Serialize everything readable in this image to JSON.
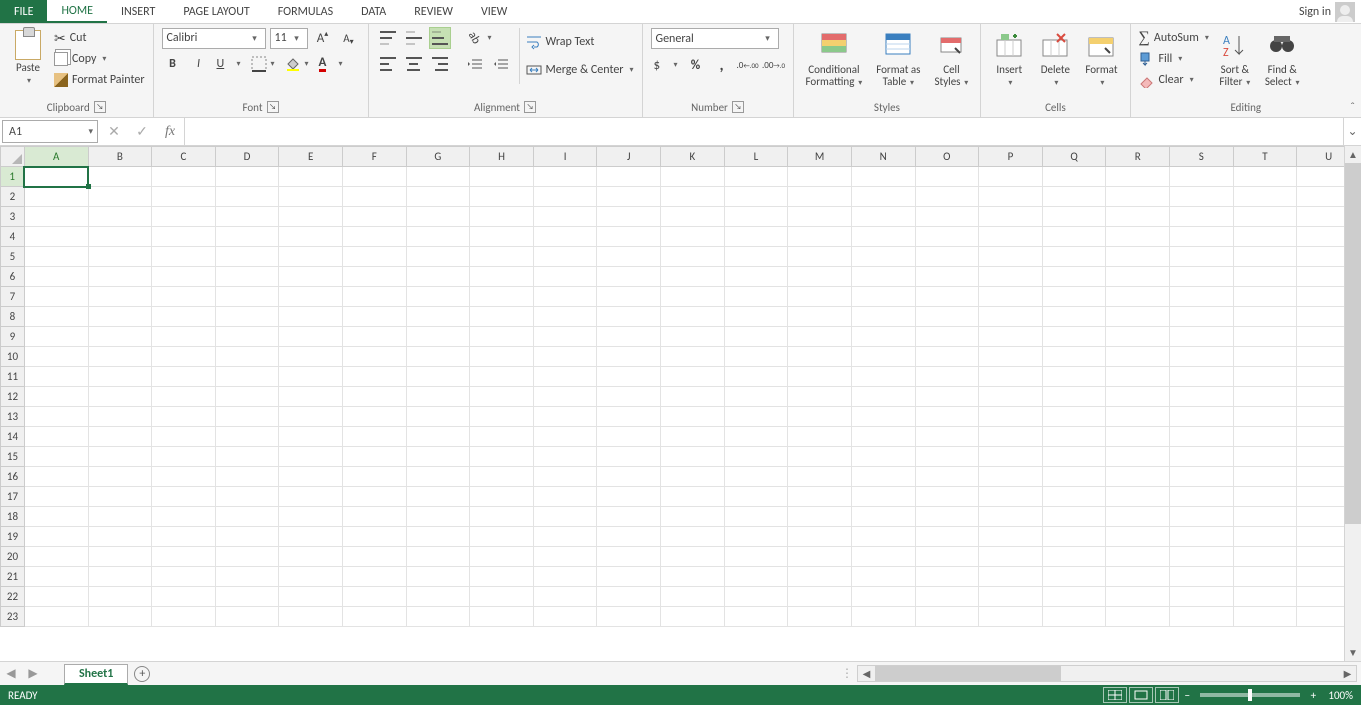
{
  "tabs": {
    "file": "FILE",
    "items": [
      "HOME",
      "INSERT",
      "PAGE LAYOUT",
      "FORMULAS",
      "DATA",
      "REVIEW",
      "VIEW"
    ],
    "active": "HOME",
    "signin": "Sign in"
  },
  "clipboard": {
    "paste": "Paste",
    "cut": "Cut",
    "copy": "Copy",
    "formatPainter": "Format Painter",
    "title": "Clipboard"
  },
  "font": {
    "name": "Calibri",
    "size": "11",
    "title": "Font"
  },
  "alignment": {
    "wrap": "Wrap Text",
    "merge": "Merge & Center",
    "title": "Alignment"
  },
  "number": {
    "format": "General",
    "title": "Number"
  },
  "styles": {
    "conditional": "Conditional\nFormatting",
    "table": "Format as\nTable",
    "cell": "Cell\nStyles",
    "title": "Styles"
  },
  "cells": {
    "insert": "Insert",
    "delete": "Delete",
    "format": "Format",
    "title": "Cells"
  },
  "editing": {
    "autosum": "AutoSum",
    "fill": "Fill",
    "clear": "Clear",
    "sort": "Sort &\nFilter",
    "find": "Find &\nSelect",
    "title": "Editing"
  },
  "formula_bar": {
    "namebox": "A1",
    "formula": ""
  },
  "grid": {
    "columns": [
      "A",
      "B",
      "C",
      "D",
      "E",
      "F",
      "G",
      "H",
      "I",
      "J",
      "K",
      "L",
      "M",
      "N",
      "O",
      "P",
      "Q",
      "R",
      "S",
      "T",
      "U"
    ],
    "rows": 23,
    "active_cell": "A1"
  },
  "sheetbar": {
    "tab": "Sheet1"
  },
  "status": {
    "mode": "READY",
    "zoom": "100%"
  }
}
